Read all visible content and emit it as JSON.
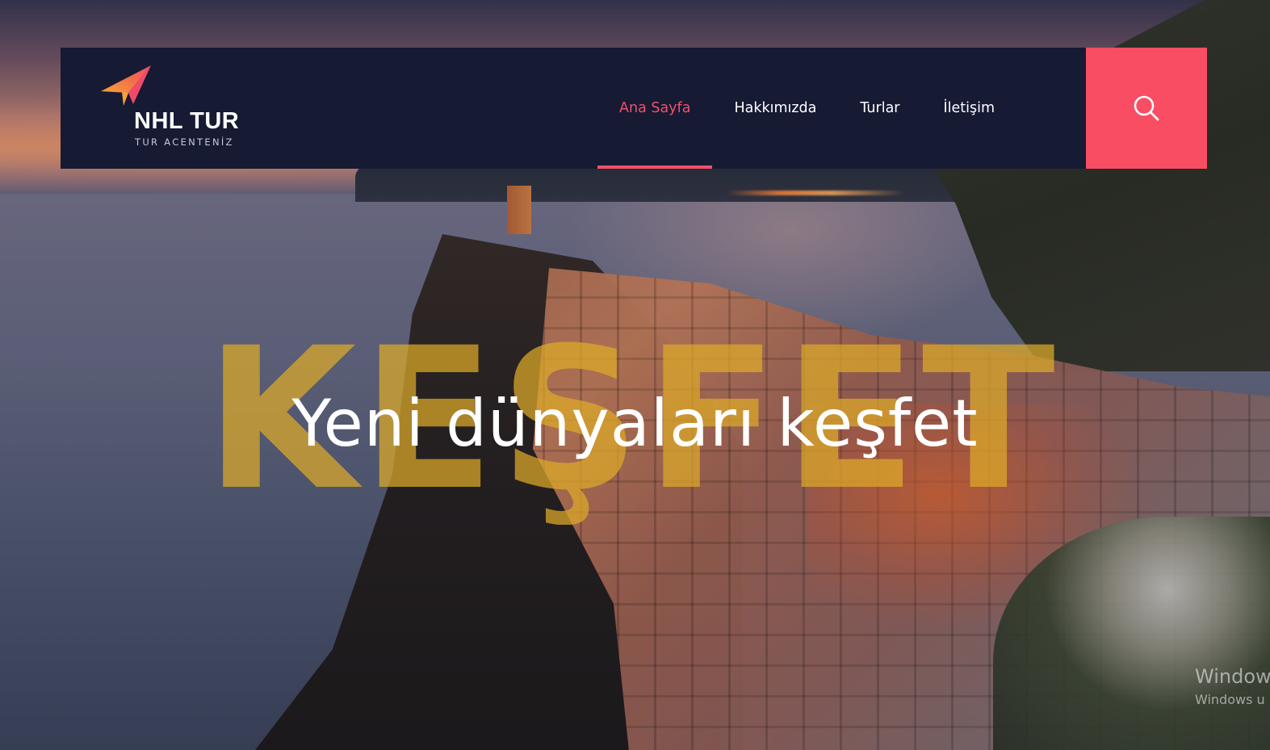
{
  "brand": {
    "name": "NHL TUR",
    "tagline": "TUR ACENTENİZ",
    "colors": {
      "accent": "#f94d64",
      "logo_orange": "#f7a23a",
      "logo_pink": "#f04a6a",
      "navbar_bg": "#161a33"
    },
    "logo_icon": "paper-plane-icon"
  },
  "nav": {
    "items": [
      {
        "label": "Ana Sayfa",
        "active": true
      },
      {
        "label": "Hakkımızda",
        "active": false
      },
      {
        "label": "Turlar",
        "active": false
      },
      {
        "label": "İletişim",
        "active": false
      }
    ],
    "search_icon": "search-icon"
  },
  "hero": {
    "background_word": "KEŞFET",
    "headline": "Yeni dünyaları keşfet",
    "background_word_color": "#deaa28"
  },
  "os_watermark": {
    "line1": "Window",
    "line2": "Windows u"
  }
}
